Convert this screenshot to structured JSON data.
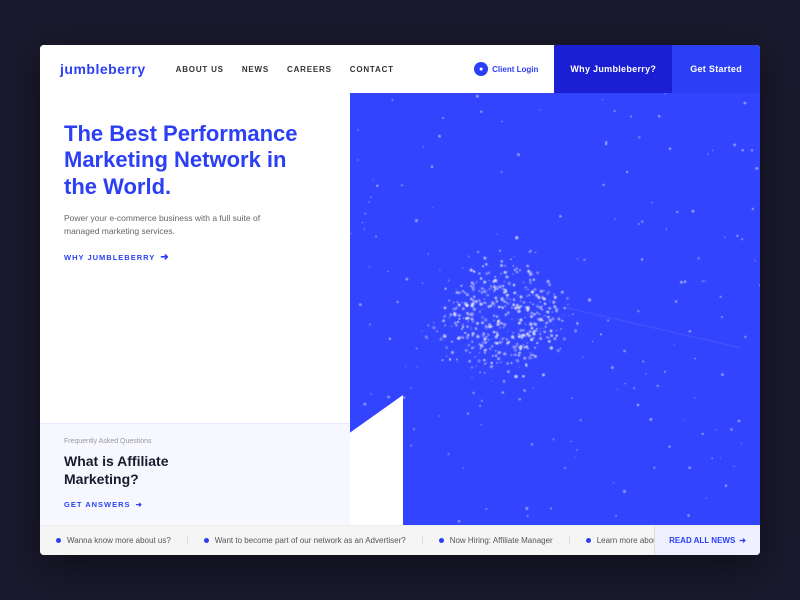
{
  "window": {
    "background": "#1a1a2e"
  },
  "navbar": {
    "logo": "jumbleberry",
    "links": [
      "ABOUT US",
      "NEWS",
      "CAREERS",
      "CONTACT"
    ],
    "client_login_label": "Client Login",
    "why_btn": "Why Jumbleberry?",
    "get_started_btn": "Get Started"
  },
  "hero": {
    "title_line1": "The Best Performance",
    "title_line2": "Marketing Network in",
    "title_line3": "the World.",
    "subtitle": "Power your e-commerce business with a full suite of managed marketing services.",
    "why_link": "WHY JUMBLEBERRY",
    "faq_label": "Frequently Asked Questions",
    "faq_title_line1": "What is Affiliate",
    "faq_title_line2": "Marketing?",
    "get_answers": "GET ANSWERS"
  },
  "ticker": {
    "items": [
      "Wanna know more about us?",
      "Want to become part of our network as an Advertiser?",
      "Now Hiring: Affiliate Manager",
      "Learn more about Jumbleberry's Advertising Policies"
    ],
    "read_all": "READ ALL NEWS"
  },
  "colors": {
    "brand_blue": "#2b3ff5",
    "hero_blue": "#3344ff",
    "dark_blue": "#1a1fd4"
  }
}
